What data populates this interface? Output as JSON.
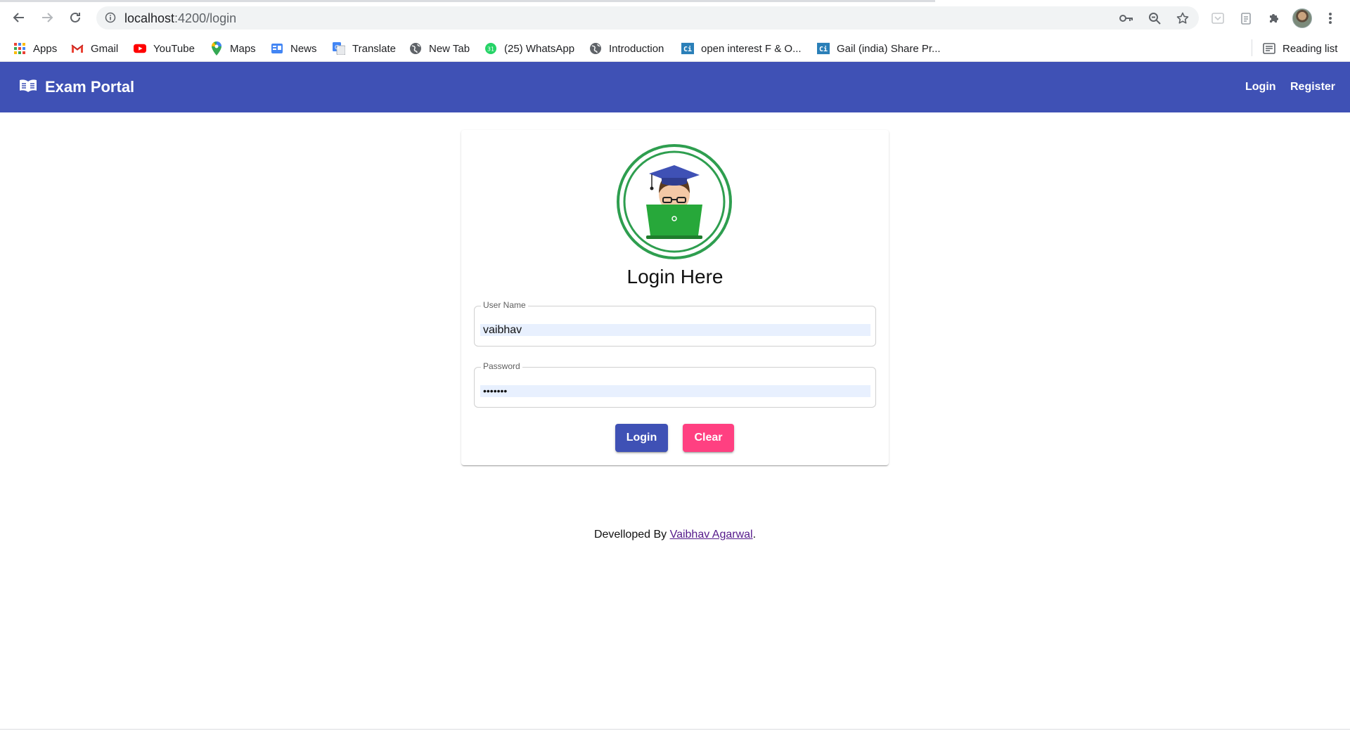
{
  "browser": {
    "url_host": "localhost",
    "url_path": ":4200/login",
    "reading_list_label": "Reading list"
  },
  "bookmarks": [
    {
      "label": "Apps",
      "icon": "apps-grid-icon"
    },
    {
      "label": "Gmail",
      "icon": "gmail-icon"
    },
    {
      "label": "YouTube",
      "icon": "youtube-icon"
    },
    {
      "label": "Maps",
      "icon": "maps-icon"
    },
    {
      "label": "News",
      "icon": "google-news-icon"
    },
    {
      "label": "Translate",
      "icon": "google-translate-icon"
    },
    {
      "label": "New Tab",
      "icon": "globe-icon"
    },
    {
      "label": "(25) WhatsApp",
      "icon": "whatsapp-icon"
    },
    {
      "label": "Introduction",
      "icon": "globe-icon"
    },
    {
      "label": "open interest F & O...",
      "icon": "ci-icon"
    },
    {
      "label": "Gail (india) Share Pr...",
      "icon": "ci-icon"
    }
  ],
  "app": {
    "brand": "Exam Portal",
    "nav": {
      "login": "Login",
      "register": "Register"
    },
    "primary_color": "#3f51b5",
    "accent_color": "#ff4081"
  },
  "login_card": {
    "title": "Login Here",
    "username": {
      "label": "User Name",
      "value": "vaibhav"
    },
    "password": {
      "label": "Password",
      "value": "•••••••"
    },
    "login_button": "Login",
    "clear_button": "Clear"
  },
  "footer": {
    "prefix": "Develloped By ",
    "author": "Vaibhav Agarwal",
    "suffix": "."
  }
}
